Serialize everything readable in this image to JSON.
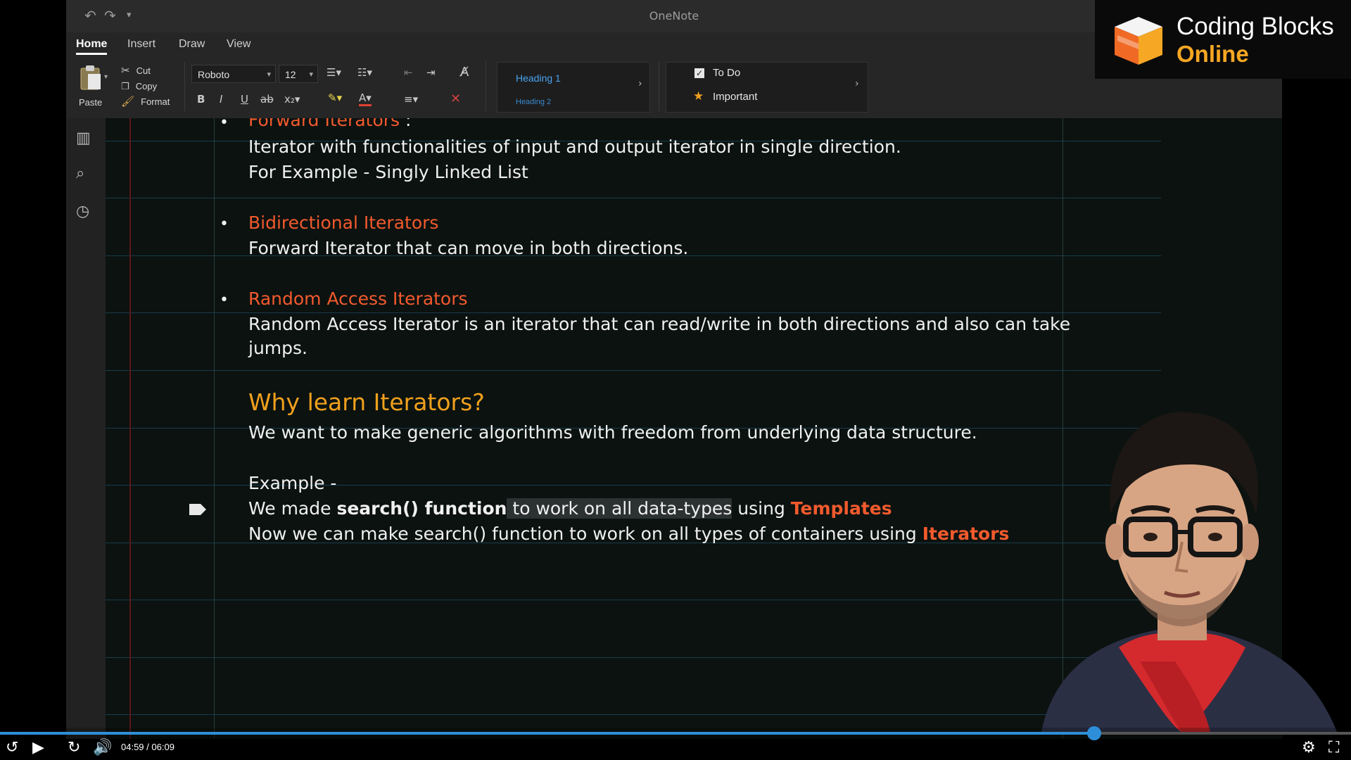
{
  "window": {
    "title": "OneNote"
  },
  "tabs": [
    {
      "label": "Home",
      "active": true
    },
    {
      "label": "Insert",
      "active": false
    },
    {
      "label": "Draw",
      "active": false
    },
    {
      "label": "View",
      "active": false
    }
  ],
  "ribbon": {
    "paste_label": "Paste",
    "cut_label": "Cut",
    "copy_label": "Copy",
    "format_label": "Format",
    "font_name": "Roboto",
    "font_size": "12",
    "styles": {
      "heading1": "Heading 1",
      "heading2": "Heading 2"
    },
    "tags": {
      "todo": "To Do",
      "important": "Important"
    },
    "icons": [
      "undo-icon",
      "redo-icon",
      "customize-icon",
      "bullets-icon",
      "numbering-icon",
      "outdent-icon",
      "indent-icon",
      "clear-format-icon",
      "bold-icon",
      "italic-icon",
      "underline-icon",
      "strikethrough-icon",
      "subscript-icon",
      "highlight-icon",
      "font-color-icon",
      "align-icon",
      "delete-icon"
    ]
  },
  "leftnav": {
    "icons": [
      "notebooks-icon",
      "search-icon",
      "recent-icon"
    ]
  },
  "note": {
    "item1": {
      "title": "Forward Iterators",
      "title_suffix": " :",
      "line1": "Iterator with functionalities of input and output iterator in single direction.",
      "line2": "For Example - Singly Linked List"
    },
    "item2": {
      "title": "Bidirectional  Iterators",
      "line1": "Forward Iterator that can move in both directions."
    },
    "item3": {
      "title": "Random Access  Iterators",
      "line1": "Random Access Iterator is an iterator that can read/write in both directions and also can take",
      "line2": "jumps."
    },
    "why": {
      "heading": "Why learn Iterators?",
      "line1": "We want to make generic algorithms with freedom from underlying data structure.",
      "example_label": "Example -",
      "line2_prefix": "We made ",
      "line2_bold": "search() function",
      "line2_selected": " to work on all data-types",
      "line2_mid": " using ",
      "line2_highlight": "Templates",
      "line3_prefix": "Now we can make search() function to work on all types of containers using ",
      "line3_highlight": "Iterators"
    }
  },
  "brand": {
    "line1": "Coding Blocks",
    "line2": "Online"
  },
  "player": {
    "time_current": "04:59",
    "time_separator": " / ",
    "time_total": "06:09",
    "progress": 0.81,
    "accent": "#2e8fd8"
  },
  "colors": {
    "accent_orange": "#f25a2d",
    "heading_gold": "#f0a01c"
  }
}
